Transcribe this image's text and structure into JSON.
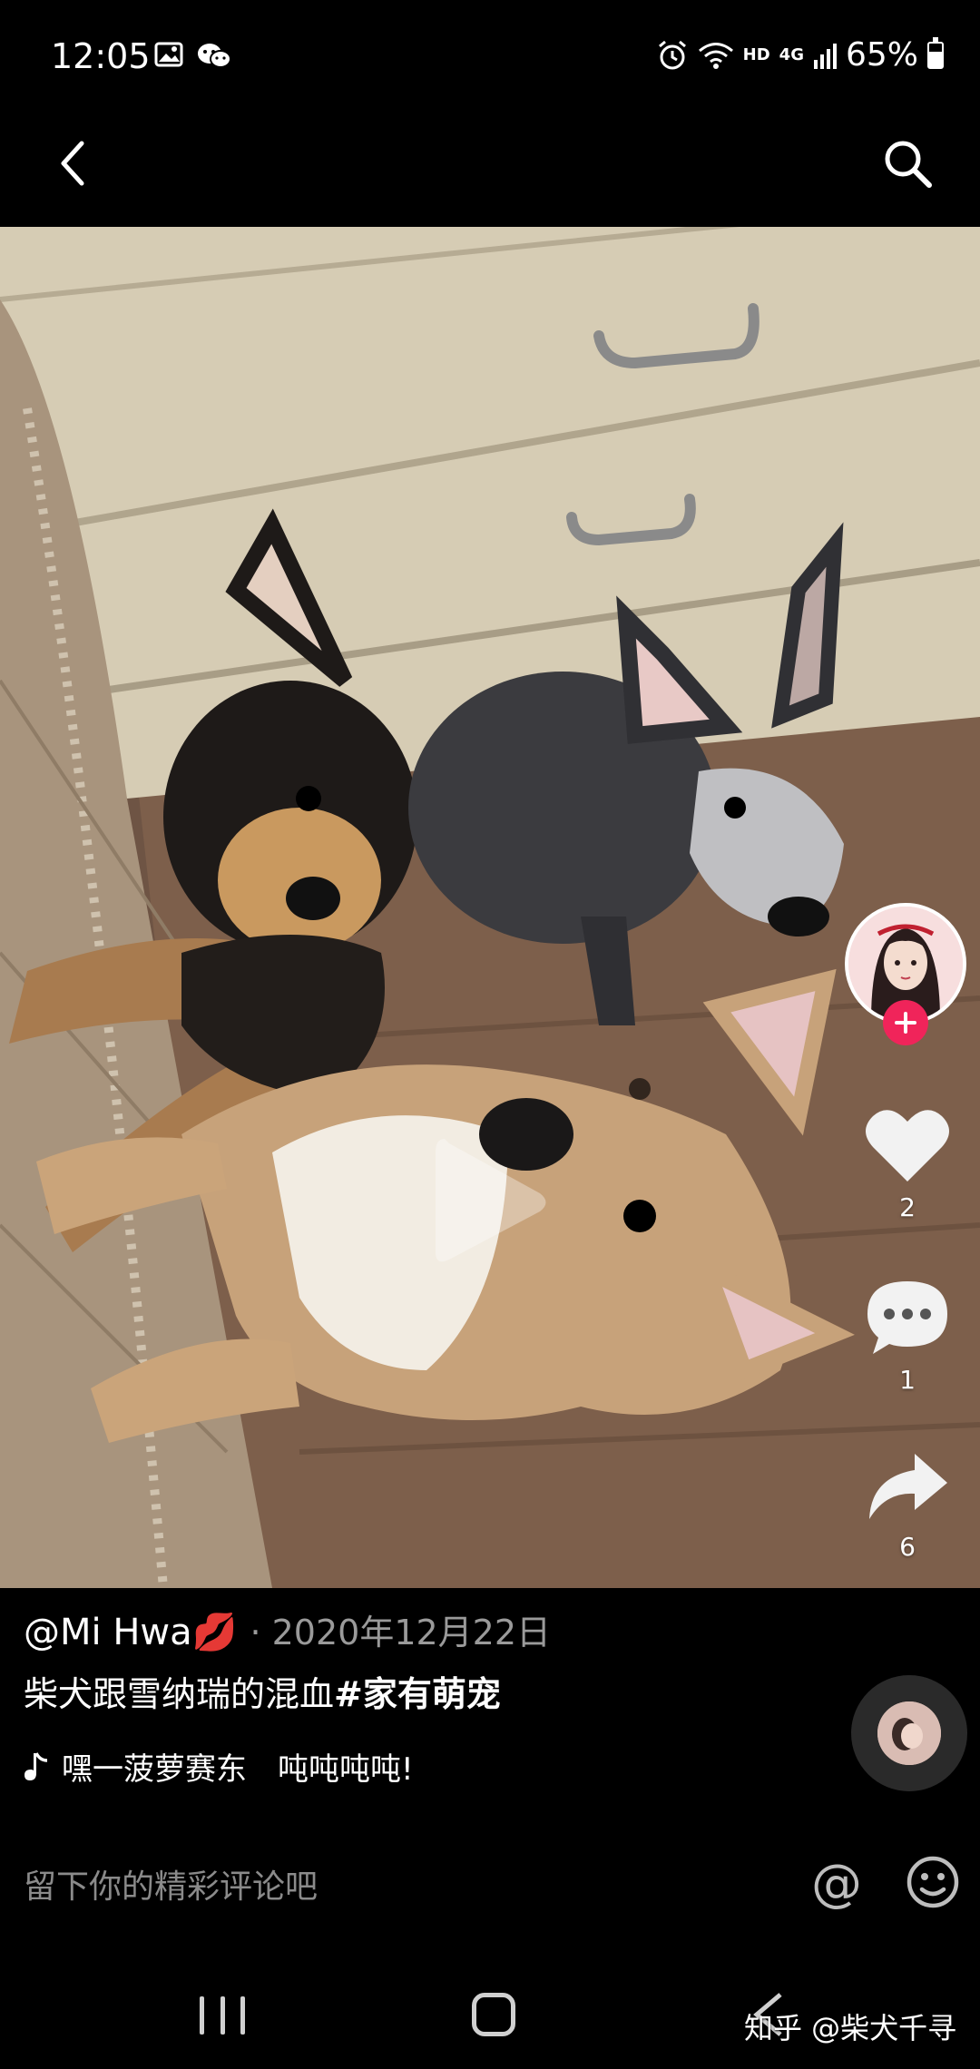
{
  "status_bar": {
    "time": "12:05",
    "network": "HD",
    "signal": "4G",
    "battery": "65%",
    "icons": [
      "image-icon",
      "wechat-icon",
      "alarm-icon",
      "wifi-icon",
      "signal-icon",
      "battery-icon"
    ]
  },
  "app_bar": {
    "icons": [
      "back-arrow-icon",
      "search-icon"
    ]
  },
  "video": {
    "player_icon": "play-icon"
  },
  "actions": {
    "like_count": "2",
    "comment_count": "1",
    "share_count": "6",
    "icons": [
      "heart-icon",
      "comment-bubble-icon",
      "share-arrow-icon",
      "plus-icon"
    ]
  },
  "post": {
    "author": "@Mi Hwa💋",
    "date": "· 2020年12月22日",
    "caption_text": "柴犬跟雪纳瑞的混血",
    "caption_hashtag": "#家有萌宠",
    "music": "嘿一菠萝赛东　吨吨吨吨!"
  },
  "comment_bar": {
    "placeholder": "留下你的精彩评论吧",
    "at_symbol": "@"
  },
  "watermark": "知乎 @柴犬千寻",
  "colors": {
    "accent_pink": "#f0245a",
    "background": "#000000",
    "muted_text": "#8a8a8a"
  }
}
